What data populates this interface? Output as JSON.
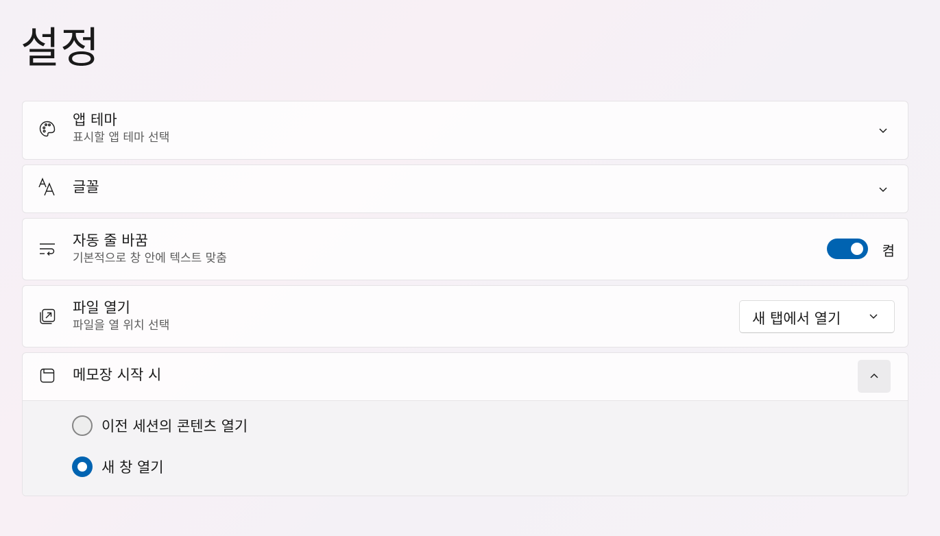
{
  "page": {
    "title": "설정"
  },
  "settings": [
    {
      "title": "앱 테마",
      "subtitle": "표시할 앱 테마 선택",
      "icon": "palette-icon"
    },
    {
      "title": "글꼴",
      "icon": "font-icon"
    },
    {
      "title": "자동 줄 바꿈",
      "subtitle": "기본적으로 창 안에 텍스트 맞춤",
      "icon": "word-wrap-icon",
      "toggle_state": "켬",
      "toggle_on": true
    },
    {
      "title": "파일 열기",
      "subtitle": "파일을 열 위치 선택",
      "icon": "open-file-icon",
      "dropdown_value": "새 탭에서 열기"
    },
    {
      "title": "메모장 시작 시",
      "icon": "window-icon",
      "options": [
        {
          "label": "이전 세션의 콘텐츠 열기",
          "selected": false
        },
        {
          "label": "새 창 열기",
          "selected": true
        }
      ]
    }
  ],
  "colors": {
    "accent": "#0063b1"
  }
}
